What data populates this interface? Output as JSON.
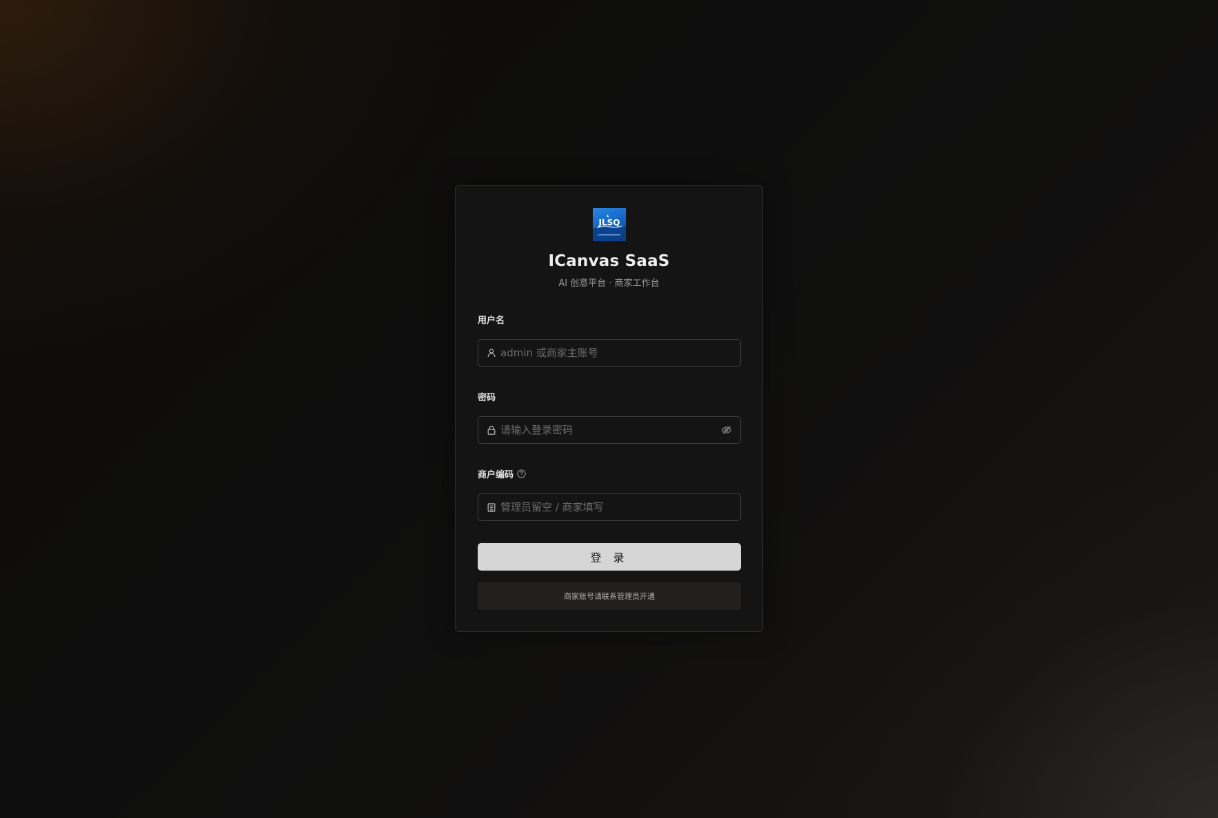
{
  "brand": {
    "logo_text": "JLSQ",
    "title": "ICanvas SaaS",
    "subtitle": "AI 创意平台 · 商家工作台"
  },
  "form": {
    "username": {
      "label": "用户名",
      "value": "",
      "placeholder": "admin 或商家主账号",
      "icon": "user-icon"
    },
    "password": {
      "label": "密码",
      "value": "",
      "placeholder": "请输入登录密码",
      "icon": "lock-icon",
      "toggle_icon": "eye-invisible-icon"
    },
    "merchant_code": {
      "label": "商户编码",
      "value": "",
      "placeholder": "管理员留空 / 商家填写",
      "icon": "building-icon",
      "help_icon": "question-circle-icon"
    },
    "submit_label": "登 录",
    "notice": "商家账号请联系管理员开通"
  },
  "colors": {
    "card_bg": "#141414",
    "button_bg": "#d6d6d6",
    "logo_bg": "#1060c0"
  }
}
